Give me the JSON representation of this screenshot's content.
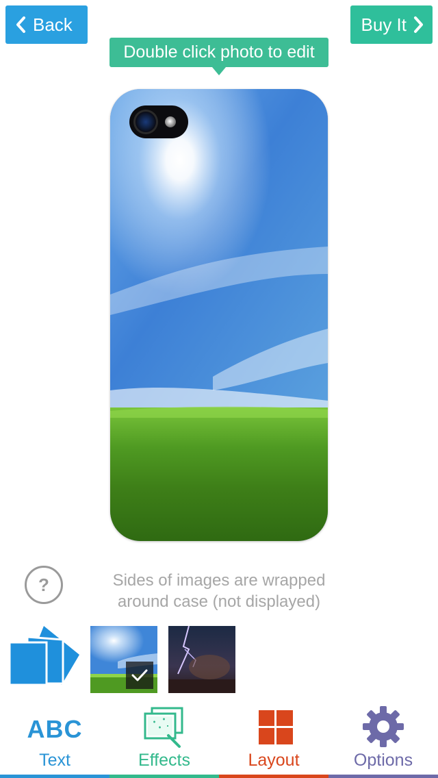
{
  "header": {
    "back_label": "Back",
    "buy_label": "Buy It"
  },
  "tooltip": {
    "text": "Double click photo to edit"
  },
  "help": {
    "icon_glyph": "?",
    "text_line1": "Sides of images are wrapped",
    "text_line2": "around case (not displayed)"
  },
  "tabs": [
    {
      "label": "Text",
      "icon_text": "ABC",
      "color": "#2a94d6"
    },
    {
      "label": "Effects",
      "color": "#33b98c"
    },
    {
      "label": "Layout",
      "color": "#d9461c"
    },
    {
      "label": "Options",
      "color": "#6d6aa8"
    }
  ],
  "colors": {
    "back": "#2aa0e0",
    "buy": "#2fbf9b",
    "tooltip": "#3dbd95"
  }
}
